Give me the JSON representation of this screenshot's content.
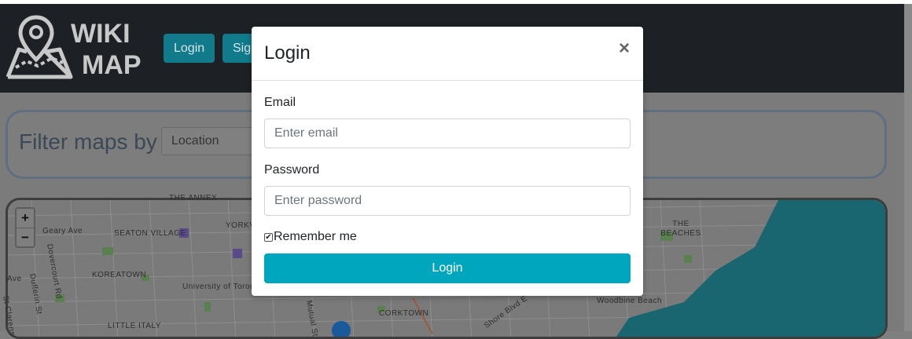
{
  "navbar": {
    "logo_text_line1": "WIKI",
    "logo_text_line2": "MAP",
    "login_label": "Login",
    "signup_label": "Sig"
  },
  "filter": {
    "label": "Filter maps by",
    "selected": "Location"
  },
  "map": {
    "zoom_in": "+",
    "zoom_out": "−",
    "labels": [
      "THE ANNEX",
      "Geary Ave",
      "SEATON VILLAGE",
      "YORKVILLE",
      "Dovercourt Rd",
      "KOREATOWN",
      "Dufferin St",
      "University of Toronto",
      "Ave",
      "St Clarens",
      "LITTLE ITALY",
      "CORKTOWN",
      "Mutual St",
      "Shore Blvd E",
      "Woodbine Beach",
      "THE BEACHES"
    ],
    "colors": {
      "land": "#7a7a7a",
      "water": "#1a6670",
      "park": "#4a7a40"
    }
  },
  "modal": {
    "title": "Login",
    "close": "×",
    "email_label": "Email",
    "email_placeholder": "Enter email",
    "password_label": "Password",
    "password_placeholder": "Enter password",
    "remember_label": "Remember me",
    "remember_checked": true,
    "submit_label": "Login"
  }
}
